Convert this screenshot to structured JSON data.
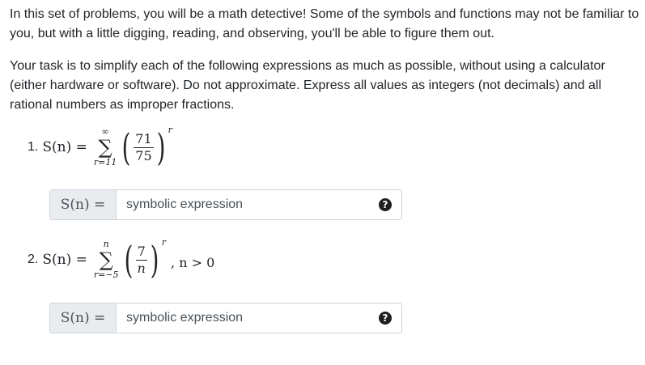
{
  "intro": {
    "paragraph1": "In this set of problems, you will be a math detective! Some of the symbols and functions may not be familiar to you, but with a little digging, reading, and observing, you'll be able to figure them out.",
    "paragraph2": "Your task is to simplify each of the following expressions as much as possible, without using a calculator (either hardware or software). Do not approximate. Express all values as integers (not decimals) and all rational numbers as improper fractions."
  },
  "problems": [
    {
      "number": "1.",
      "lhs": "S(n) =",
      "sum_upper": "∞",
      "sum_lower": "r=11",
      "fraction_numerator": "71",
      "fraction_denominator": "75",
      "exponent": "r",
      "condition": "",
      "answer_label": "S(n) =",
      "answer_placeholder": "symbolic expression",
      "help_icon": "?"
    },
    {
      "number": "2.",
      "lhs": "S(n) =",
      "sum_upper": "n",
      "sum_lower": "r=−5",
      "fraction_numerator": "7",
      "fraction_denominator": "n",
      "exponent": "r",
      "condition": ", n > 0",
      "answer_label": "S(n) =",
      "answer_placeholder": "symbolic expression",
      "help_icon": "?"
    }
  ]
}
